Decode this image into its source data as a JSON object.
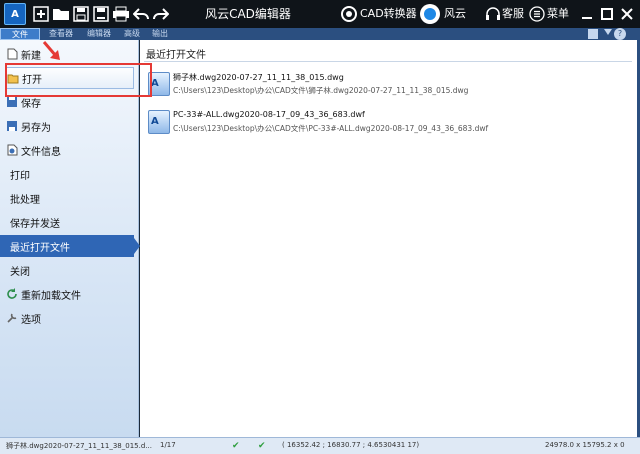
{
  "titlebar": {
    "title": "风云CAD编辑器",
    "cad_converter": "CAD转换器",
    "fengyun": "风云",
    "customer_service": "客服",
    "menu": "菜单"
  },
  "menubar": {
    "tabs": [
      "文件",
      "查看器",
      "编辑器",
      "高级",
      "输出"
    ]
  },
  "backstage": {
    "items": [
      {
        "label": "新建",
        "icon": "new-file-icon"
      },
      {
        "label": "打开",
        "icon": "open-folder-icon"
      },
      {
        "label": "保存",
        "icon": "save-icon"
      },
      {
        "label": "另存为",
        "icon": "save-as-icon"
      },
      {
        "label": "文件信息",
        "icon": "file-info-icon"
      },
      {
        "label": "打印"
      },
      {
        "label": "批处理"
      },
      {
        "label": "保存并发送"
      },
      {
        "label": "最近打开文件"
      },
      {
        "label": "关闭"
      },
      {
        "label": "重新加载文件",
        "icon": "reload-icon"
      },
      {
        "label": "选项",
        "icon": "options-icon"
      }
    ]
  },
  "main": {
    "title": "最近打开文件",
    "recent": [
      {
        "name": "狮子林.dwg2020-07-27_11_11_38_015.dwg",
        "path": "C:\\Users\\123\\Desktop\\办公\\CAD文件\\狮子林.dwg2020-07-27_11_11_38_015.dwg"
      },
      {
        "name": "PC-33#-ALL.dwg2020-08-17_09_43_36_683.dwf",
        "path": "C:\\Users\\123\\Desktop\\办公\\CAD文件\\PC-33#-ALL.dwg2020-08-17_09_43_36_683.dwf"
      }
    ]
  },
  "statusbar": {
    "file": "狮子林.dwg2020-07-27_11_11_38_015.d...",
    "page": "1/17",
    "coords": "( 16352.42 ; 16830.77 ; 4.6530431 17)",
    "size": "24978.0 x 15795.2 x 0"
  },
  "colors": {
    "titlebar": "#0f1419",
    "ribbon": "#2b4f80",
    "selected": "#2f66b5",
    "annotation": "#e53935"
  }
}
